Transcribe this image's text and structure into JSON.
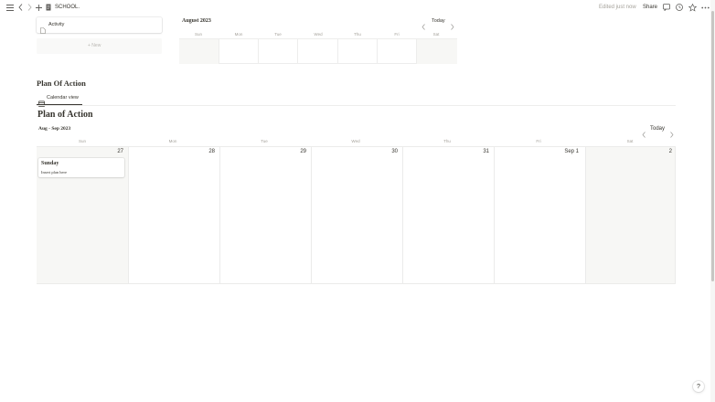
{
  "topbar": {
    "breadcrumb": "SCHOOL.",
    "edited": "Edited just now",
    "share": "Share"
  },
  "board": {
    "card_title": "Activity",
    "new_label": "+ New"
  },
  "mini_calendar": {
    "month": "August 2023",
    "today": "Today",
    "days": [
      "Sun",
      "Mon",
      "Tue",
      "Wed",
      "Thu",
      "Fri",
      "Sat"
    ]
  },
  "plan": {
    "heading": "Plan Of Action",
    "view_tab": "Calendar view",
    "title": "Plan of Action",
    "range": "Aug - Sep 2023",
    "today": "Today",
    "days": [
      "Sun",
      "Mon",
      "Tue",
      "Wed",
      "Thu",
      "Fri",
      "Sat"
    ],
    "dates": [
      "27",
      "28",
      "29",
      "30",
      "31",
      "Sep 1",
      "2"
    ],
    "event": {
      "title": "Sunday",
      "note": "Insert plan here"
    }
  },
  "help": "?",
  "icons": {
    "menu": "menu-icon",
    "back": "chevron-left-icon",
    "forward": "chevron-right-icon",
    "add": "plus-icon",
    "page": "page-icon",
    "comment": "comment-icon",
    "history": "clock-icon",
    "favorite": "star-icon",
    "more": "more-icon",
    "calendar": "calendar-icon"
  },
  "colors": {
    "text": "#37352f",
    "muted": "#a5a29b",
    "weekend_bg": "#f7f7f5"
  }
}
